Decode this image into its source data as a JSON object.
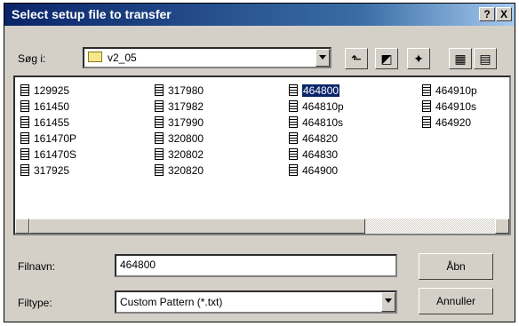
{
  "title": "Select setup file to transfer",
  "title_buttons": {
    "help": "?",
    "close": "X"
  },
  "look_in": {
    "label": "Søg i:",
    "value": "v2_05"
  },
  "toolbar": [
    {
      "name": "up-folder-icon",
      "glyph": "⬑"
    },
    {
      "name": "desktop-icon",
      "glyph": "◩"
    },
    {
      "name": "new-folder-icon",
      "glyph": "✦"
    },
    {
      "name": "list-view-icon",
      "glyph": "▦"
    },
    {
      "name": "details-view-icon",
      "glyph": "▤"
    }
  ],
  "files": [
    [
      "129925",
      "161450",
      "161455",
      "161470P",
      "161470S",
      "317925"
    ],
    [
      "317980",
      "317982",
      "317990",
      "320800",
      "320802",
      "320820"
    ],
    [
      "464800",
      "464810p",
      "464810s",
      "464820",
      "464830",
      "464900"
    ],
    [
      "464910p",
      "464910s",
      "464920"
    ]
  ],
  "selected_file": "464800",
  "filename": {
    "label": "Filnavn:",
    "value": "464800"
  },
  "filetype": {
    "label": "Filtype:",
    "value": "Custom Pattern (*.txt)"
  },
  "buttons": {
    "open": "Åbn",
    "cancel": "Annuller"
  }
}
